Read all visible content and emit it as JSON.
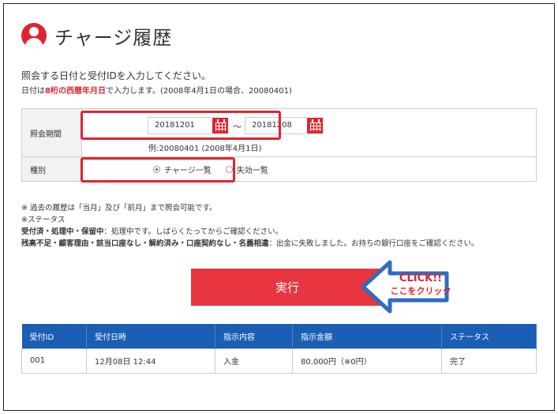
{
  "header": {
    "title": "チャージ履歴",
    "icon": "user-icon"
  },
  "instruction": "照会する日付と受付IDを入力してください。",
  "format_note": {
    "prefix": "日付は",
    "emphasis": "8桁の西暦年月日",
    "suffix": "で入力します。(2008年4月1日の場合、20080401)"
  },
  "form": {
    "period_label": "照会期間",
    "date_from": "20181201",
    "tilde": "〜",
    "date_to": "20181208",
    "date_example": "例:20080401 (2008年4月1日)",
    "type_label": "種別",
    "options": [
      {
        "label": "チャージ一覧",
        "selected": true
      },
      {
        "label": "失効一覧",
        "selected": false
      }
    ]
  },
  "notes": {
    "line1": "※ 過去の履歴は「当月」及び「前月」まで照会可能です。",
    "line2": "※ステータス",
    "line3_bold": "受付済・処理中・保留中",
    "line3_rest": "：処理中です。しばらくたってからご確認ください。",
    "line4_bold": "残高不足・顧客理由・該当口座なし・解約済み・口座契約なし・名義相違",
    "line4_rest": "：出金に失敗しました。お持ちの銀行口座をご確認ください。"
  },
  "execute_label": "実行",
  "callout": {
    "line1": "CLICK!!",
    "line2": "ここをクリック"
  },
  "results": {
    "headers": [
      "受付ID",
      "受付日時",
      "指示内容",
      "指示金額",
      "ステータス"
    ],
    "rows": [
      [
        "001",
        "12月08日 12:44",
        "入金",
        "80,000円（※0円）",
        "完了"
      ]
    ]
  },
  "colors": {
    "accent": "#e0242f",
    "button": "#e83540",
    "table_header": "#1a5fb4",
    "callout_arrow": "#2f6cc0"
  }
}
